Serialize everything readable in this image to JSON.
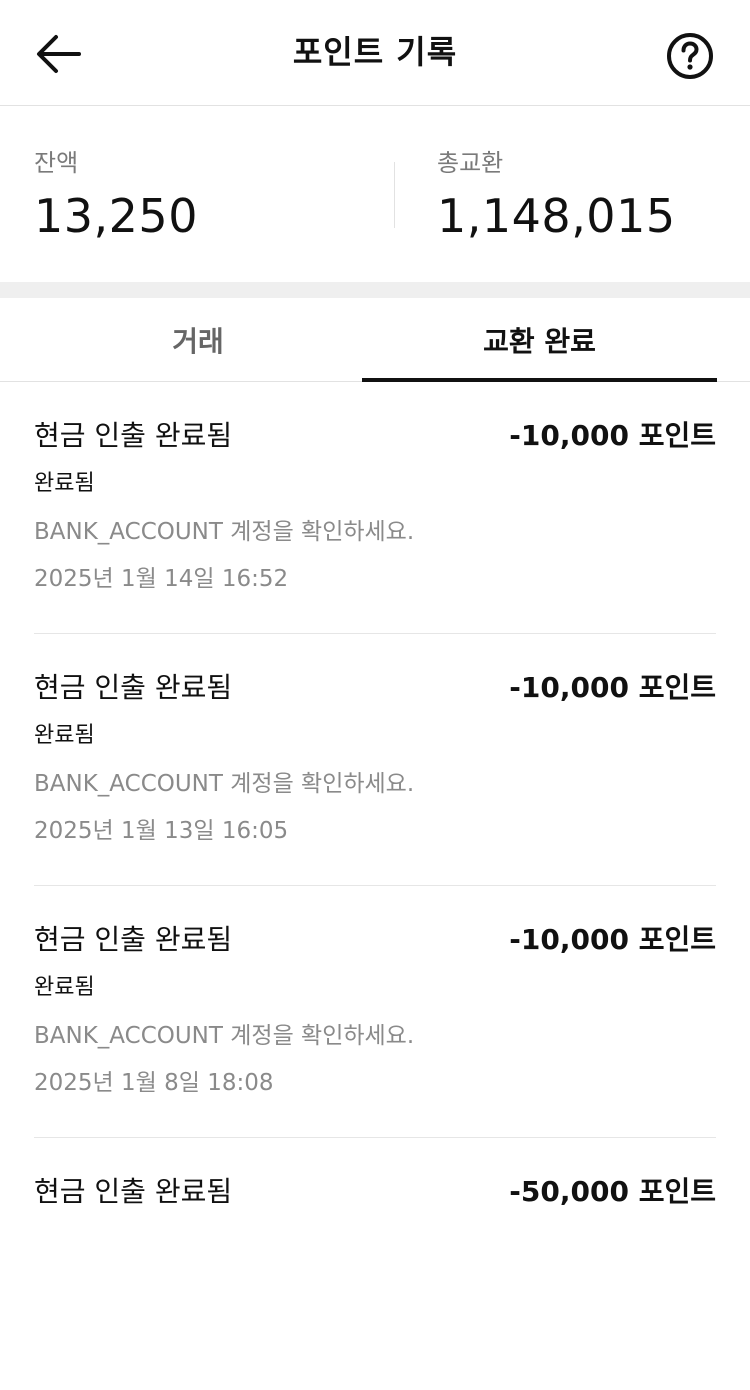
{
  "header": {
    "title": "포인트 기록",
    "back_icon": "arrow-left-icon",
    "help_icon": "question-circle-icon"
  },
  "summary": {
    "balance_label": "잔액",
    "balance_value": "13,250",
    "total_label": "총교환",
    "total_value": "1,148,015"
  },
  "tabs": [
    {
      "label": "거래",
      "active": false
    },
    {
      "label": "교환 완료",
      "active": true
    }
  ],
  "items": [
    {
      "title": "현금 인출 완료됨",
      "amount": "-10,000 포인트",
      "status": "완료됨",
      "desc": "BANK_ACCOUNT 계정을 확인하세요.",
      "date": "2025년 1월 14일 16:52"
    },
    {
      "title": "현금 인출 완료됨",
      "amount": "-10,000 포인트",
      "status": "완료됨",
      "desc": "BANK_ACCOUNT 계정을 확인하세요.",
      "date": "2025년 1월 13일 16:05"
    },
    {
      "title": "현금 인출 완료됨",
      "amount": "-10,000 포인트",
      "status": "완료됨",
      "desc": "BANK_ACCOUNT 계정을 확인하세요.",
      "date": "2025년 1월 8일 18:08"
    },
    {
      "title": "현금 인출 완료됨",
      "amount": "-50,000 포인트"
    }
  ],
  "colors": {
    "text": "#111111",
    "muted": "#8a8a8a",
    "divider": "#e2e2e2",
    "section_gap": "#efefef"
  }
}
